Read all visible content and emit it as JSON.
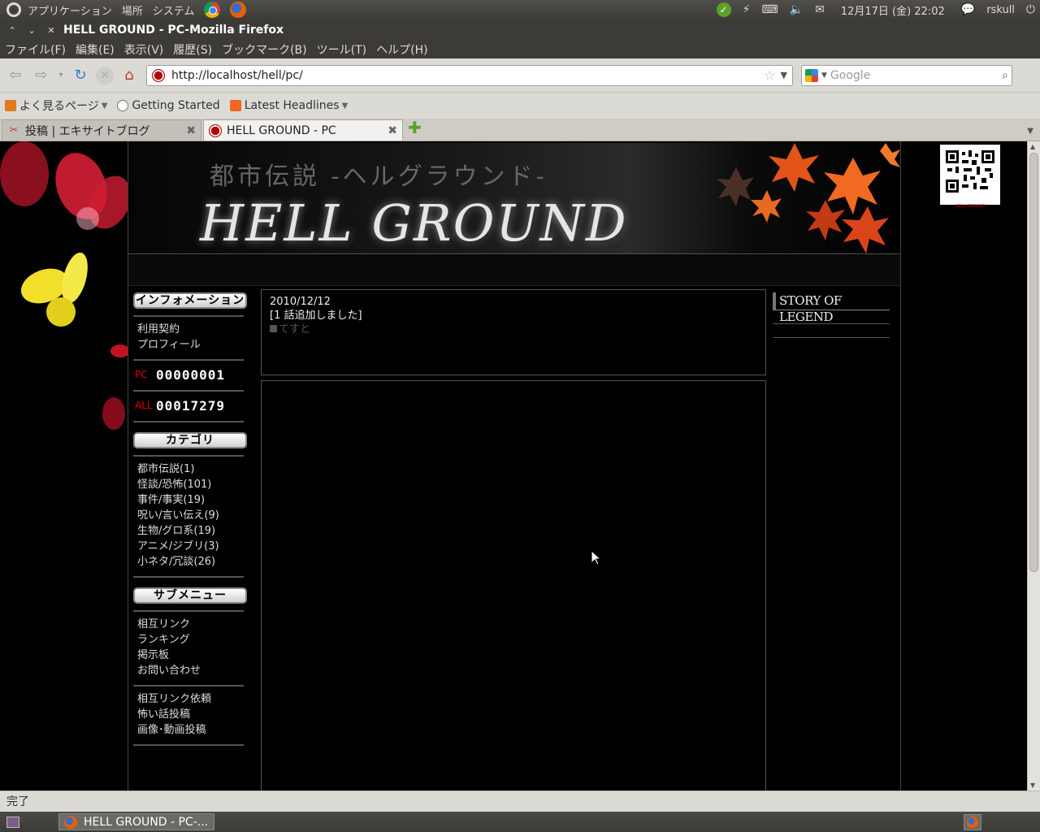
{
  "top_panel": {
    "menus": [
      "アプリケーション",
      "場所",
      "システム"
    ],
    "clock": "12月17日 (金) 22:02",
    "user": "rskull"
  },
  "window": {
    "title": "HELL GROUND - PC-Mozilla Firefox"
  },
  "menubar": [
    "ファイル(F)",
    "編集(E)",
    "表示(V)",
    "履歴(S)",
    "ブックマーク(B)",
    "ツール(T)",
    "ヘルプ(H)"
  ],
  "navbar": {
    "url": "http://localhost/hell/pc/",
    "search_placeholder": "Google"
  },
  "bookmarks": [
    "よく見るページ",
    "Getting Started",
    "Latest Headlines"
  ],
  "tabs": [
    {
      "label": "投稿 | エキサイトブログ",
      "active": false
    },
    {
      "label": "HELL GROUND - PC",
      "active": true
    }
  ],
  "page": {
    "banner_sub": "都市伝説 -ヘルグラウンド-",
    "banner_title": "HELL GROUND",
    "info_heading": "インフォメーション",
    "info_links": [
      "利用契約",
      "プロフィール"
    ],
    "counters": [
      {
        "label": "PC",
        "value": "00000001"
      },
      {
        "label": "ALL",
        "value": "00017279"
      }
    ],
    "category_heading": "カテゴリ",
    "categories": [
      "都市伝説(1)",
      "怪談/恐怖(101)",
      "事件/事実(19)",
      "呪い/言い伝え(9)",
      "生物/グロ系(19)",
      "アニメ/ジブリ(3)",
      "小ネタ/冗談(26)"
    ],
    "submenu_heading": "サブメニュー",
    "submenu_links": [
      "相互リンク",
      "ランキング",
      "掲示板",
      "お問い合わせ"
    ],
    "extra_links": [
      "相互リンク依頼",
      "怖い話投稿",
      "画像･動画投稿"
    ],
    "news": {
      "date": "2010/12/12",
      "text": "[1 話追加しました]",
      "test": "てすと"
    },
    "right_title": "STORY OF LEGEND",
    "qr_caption": "HELL GROUND"
  },
  "statusbar": "完了",
  "taskbar": {
    "item": "HELL GROUND - PC-..."
  }
}
